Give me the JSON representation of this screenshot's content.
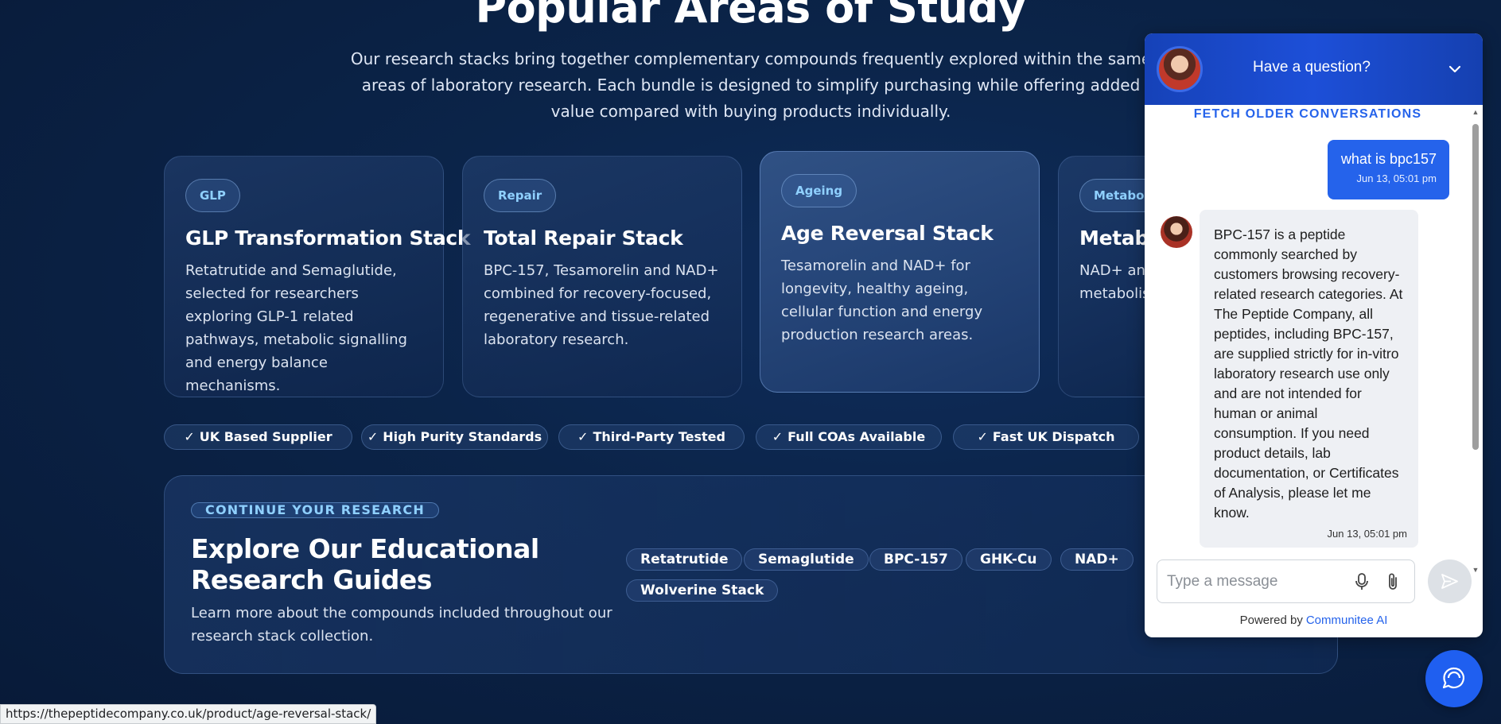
{
  "hero": {
    "title": "Popular Areas of Study",
    "description": "Our research stacks bring together complementary compounds frequently explored within the same areas of laboratory research. Each bundle is designed to simplify purchasing while offering added value compared with buying products individually."
  },
  "cards": [
    {
      "tag": "GLP",
      "title": "GLP Transformation Stack",
      "text": "Retatrutide and Semaglutide, selected for researchers exploring GLP-1 related pathways, metabolic signalling and energy balance mechanisms."
    },
    {
      "tag": "Repair",
      "title": "Total Repair Stack",
      "text": "BPC-157, Tesamorelin and NAD+ combined for recovery-focused, regenerative and tissue-related laboratory research."
    },
    {
      "tag": "Ageing",
      "title": "Age Reversal Stack",
      "text": "Tesamorelin and NAD+ for longevity, healthy ageing, cellular function and energy production research areas."
    },
    {
      "tag": "Metabolic",
      "title": "Metabolic",
      "text": "NAD+ and ... together f... metabolis... metabolic..."
    }
  ],
  "badges": [
    {
      "check": "✓",
      "label": "UK Based Supplier"
    },
    {
      "check": "✓",
      "label": "High Purity Standards"
    },
    {
      "check": "✓",
      "label": "Third-Party Tested"
    },
    {
      "check": "✓",
      "label": "Full COAs Available"
    },
    {
      "check": "✓",
      "label": "Fast UK Dispatch"
    }
  ],
  "guides": {
    "eyebrow": "CONTINUE YOUR RESEARCH",
    "heading": "Explore Our Educational Research Guides",
    "sub": "Learn more about the compounds included throughout our research stack collection.",
    "pills": [
      "Retatrutide",
      "Semaglutide",
      "BPC-157",
      "GHK-Cu",
      "NAD+",
      "Wolverine Stack"
    ]
  },
  "status_url": "https://thepeptidecompany.co.uk/product/age-reversal-stack/",
  "chat": {
    "title": "Have a question?",
    "fetch_older": "FETCH OLDER CONVERSATIONS",
    "user_message": {
      "text": "what is bpc157",
      "time": "Jun 13, 05:01 pm"
    },
    "bot_message": {
      "text": "BPC-157 is a peptide commonly searched by customers browsing recovery-related research categories. At The Peptide Company, all peptides, including BPC-157, are supplied strictly for in-vitro laboratory research use only and are not intended for human or animal consumption. If you need product details, lab documentation, or Certificates of Analysis, please let me know.",
      "time": "Jun 13, 05:01 pm"
    },
    "input_placeholder": "Type a message",
    "powered_by": "Powered by",
    "brand": "Communitee AI",
    "accent": "#1d4fd8"
  }
}
